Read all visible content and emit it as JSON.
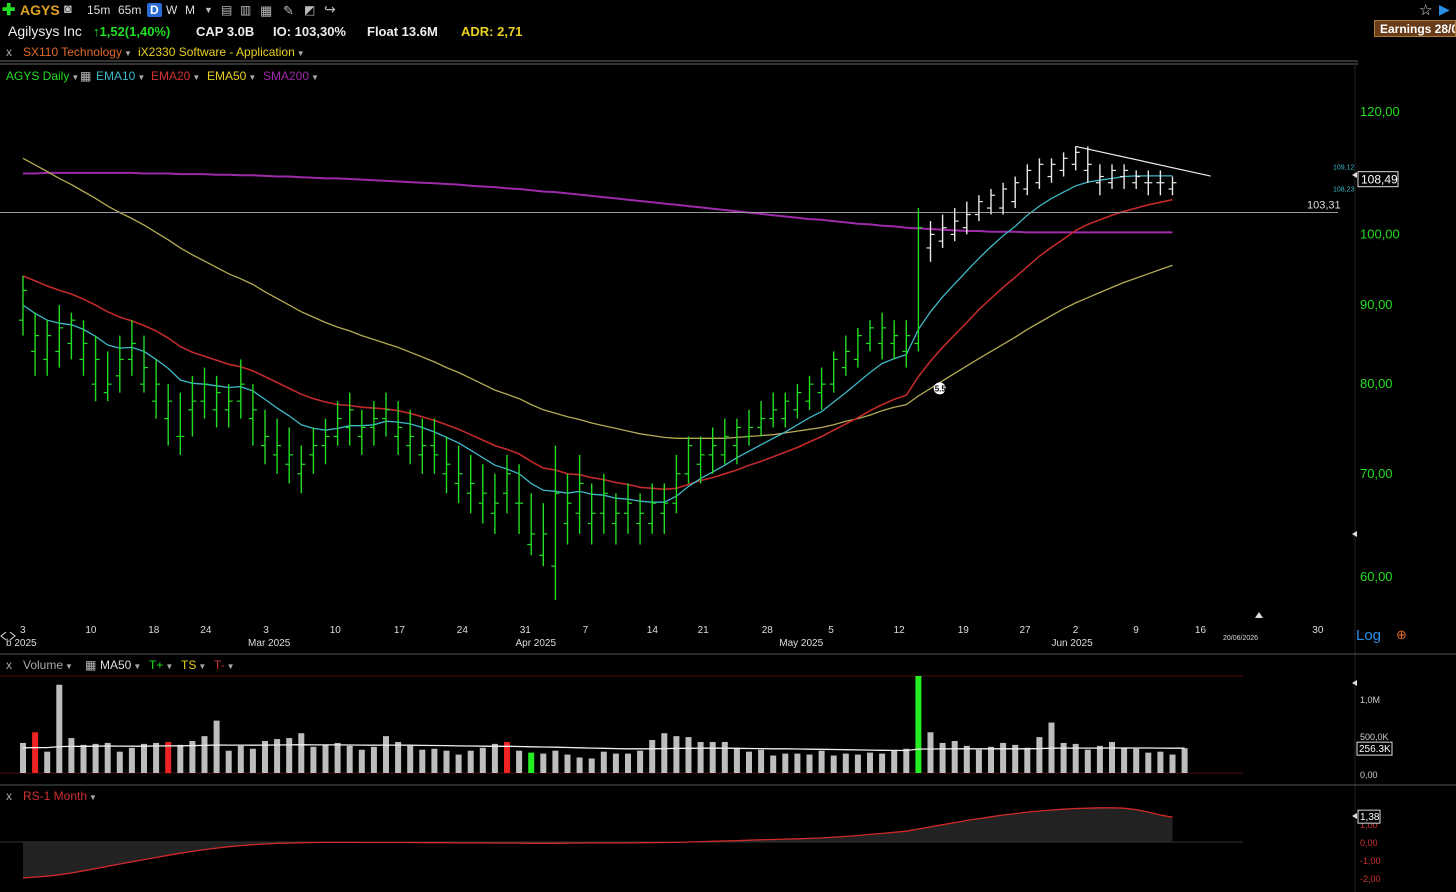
{
  "toolbar": {
    "symbol": "AGYS",
    "intervals": [
      "15m",
      "65m",
      "D",
      "W",
      "M"
    ],
    "active_interval": "D"
  },
  "info": {
    "company": "Agilysys Inc",
    "change": "1,52(1,40%)",
    "cap": "CAP 3.0B",
    "io": "IO: 103,30%",
    "float": "Float 13.6M",
    "adr": "ADR: 2,71",
    "earnings": "Earnings 28/0"
  },
  "sector": {
    "sx": "SX110 Technology",
    "ix": "iX2330 Software - Application"
  },
  "legend": {
    "symbol": "AGYS Daily",
    "ema10": "EMA10",
    "ema20": "EMA20",
    "ema50": "EMA50",
    "sma200": "SMA200"
  },
  "colors": {
    "price": "#22dd22",
    "ema10": "#3fb8c8",
    "ema20": "#c02a2a",
    "ema50": "#b3ab55",
    "sma200": "#9d2aa8",
    "volume_up": "#bdbdbd",
    "volume_hi_green": "#22ee22",
    "volume_hi_red": "#ee2222",
    "rs_line": "#d02a2a"
  },
  "price_axis": {
    "ticks": [
      "120,00",
      "100,00",
      "90,00",
      "80,00",
      "70,00",
      "60,00"
    ],
    "last_price": "108,49",
    "ema10_tag": "109,12",
    "ema20_tag": "108,23",
    "line_label": "103,31",
    "annotation": "5.54",
    "scale": "Log"
  },
  "xaxis": {
    "day_ticks": [
      "3",
      "10",
      "18",
      "24",
      "3",
      "10",
      "17",
      "24",
      "31",
      "7",
      "14",
      "21",
      "28",
      "5",
      "12",
      "19",
      "27",
      "2",
      "9",
      "16",
      "30"
    ],
    "month_labels": [
      "b 2025",
      "Mar 2025",
      "Apr 2025",
      "May 2025",
      "Jun 2025"
    ],
    "current_date": "20/06/2026"
  },
  "volume_panel": {
    "title": "Volume",
    "ma": "MA50",
    "tplus": "T+",
    "ts": "TS",
    "tminus": "T-",
    "ticks": [
      "1,0M",
      "500,0K",
      "0,00"
    ],
    "current": "256.3K"
  },
  "rs_panel": {
    "title": "RS-1 Month",
    "current": "1,38",
    "ticks": [
      "1,00",
      "0,00",
      "-1,00",
      "-2,00"
    ]
  },
  "chart_data": {
    "type": "ohlc",
    "title": "AGYS Daily",
    "ylim": [
      58,
      124
    ],
    "yscale": "log",
    "dates": [
      "2025-02-03",
      "2025-02-04",
      "2025-02-05",
      "2025-02-06",
      "2025-02-07",
      "2025-02-10",
      "2025-02-11",
      "2025-02-12",
      "2025-02-13",
      "2025-02-14",
      "2025-02-18",
      "2025-02-19",
      "2025-02-20",
      "2025-02-21",
      "2025-02-24",
      "2025-02-25",
      "2025-02-26",
      "2025-02-27",
      "2025-02-28",
      "2025-03-03",
      "2025-03-04",
      "2025-03-05",
      "2025-03-06",
      "2025-03-07",
      "2025-03-10",
      "2025-03-11",
      "2025-03-12",
      "2025-03-13",
      "2025-03-14",
      "2025-03-17",
      "2025-03-18",
      "2025-03-19",
      "2025-03-20",
      "2025-03-21",
      "2025-03-24",
      "2025-03-25",
      "2025-03-26",
      "2025-03-27",
      "2025-03-28",
      "2025-03-31",
      "2025-04-01",
      "2025-04-02",
      "2025-04-03",
      "2025-04-04",
      "2025-04-07",
      "2025-04-08",
      "2025-04-09",
      "2025-04-10",
      "2025-04-11",
      "2025-04-14",
      "2025-04-15",
      "2025-04-16",
      "2025-04-17",
      "2025-04-21",
      "2025-04-22",
      "2025-04-23",
      "2025-04-24",
      "2025-04-25",
      "2025-04-28",
      "2025-04-29",
      "2025-04-30",
      "2025-05-01",
      "2025-05-02",
      "2025-05-05",
      "2025-05-06",
      "2025-05-07",
      "2025-05-08",
      "2025-05-09",
      "2025-05-12",
      "2025-05-13",
      "2025-05-14",
      "2025-05-15",
      "2025-05-16",
      "2025-05-19",
      "2025-05-20",
      "2025-05-21",
      "2025-05-22",
      "2025-05-23",
      "2025-05-27",
      "2025-05-28",
      "2025-05-29",
      "2025-05-30",
      "2025-06-02",
      "2025-06-03",
      "2025-06-04",
      "2025-06-05",
      "2025-06-06",
      "2025-06-09",
      "2025-06-10",
      "2025-06-11",
      "2025-06-12",
      "2025-06-13",
      "2025-06-16",
      "2025-06-17",
      "2025-06-18",
      "2025-06-20"
    ],
    "ohlc": [
      [
        88,
        94,
        86,
        92
      ],
      [
        84,
        89,
        81,
        86
      ],
      [
        83,
        88,
        81,
        86
      ],
      [
        84,
        90,
        82,
        87
      ],
      [
        85,
        89,
        83,
        88
      ],
      [
        83,
        88,
        81,
        85
      ],
      [
        80,
        86,
        78,
        83
      ],
      [
        79,
        84,
        78,
        80
      ],
      [
        81,
        86,
        79,
        83
      ],
      [
        83,
        88,
        81,
        85
      ],
      [
        80,
        86,
        79,
        82
      ],
      [
        78,
        83,
        76,
        80
      ],
      [
        76,
        80,
        73,
        78
      ],
      [
        74,
        79,
        72,
        74
      ],
      [
        77,
        81,
        74,
        78
      ],
      [
        78,
        82,
        76,
        80
      ],
      [
        77,
        81,
        75,
        79
      ],
      [
        77,
        80,
        75,
        78
      ],
      [
        78,
        83,
        76,
        80
      ],
      [
        76,
        80,
        73,
        77
      ],
      [
        73,
        77,
        71,
        74
      ],
      [
        72,
        76,
        70,
        73
      ],
      [
        71,
        75,
        69,
        72
      ],
      [
        70,
        73,
        68,
        71
      ],
      [
        72,
        75,
        70,
        73
      ],
      [
        73,
        76,
        71,
        74
      ],
      [
        74,
        78,
        73,
        76
      ],
      [
        75,
        79,
        73,
        77
      ],
      [
        74,
        77,
        72,
        75
      ],
      [
        75,
        78,
        73,
        76
      ],
      [
        76,
        79,
        74,
        77
      ],
      [
        74,
        78,
        72,
        75
      ],
      [
        73,
        77,
        71,
        74
      ],
      [
        72,
        76,
        70,
        73
      ],
      [
        73,
        76,
        70,
        72
      ],
      [
        70,
        74,
        68,
        71
      ],
      [
        69,
        73,
        67,
        70
      ],
      [
        68,
        72,
        66,
        69
      ],
      [
        67,
        71,
        65,
        68
      ],
      [
        66,
        70,
        64,
        67
      ],
      [
        68,
        72,
        66,
        70
      ],
      [
        67,
        71,
        64,
        67
      ],
      [
        63,
        68,
        62,
        64
      ],
      [
        62,
        67,
        61,
        64
      ],
      [
        61,
        73,
        58,
        68
      ],
      [
        65,
        70,
        63,
        67
      ],
      [
        66,
        72,
        64,
        69
      ],
      [
        65,
        69,
        63,
        66
      ],
      [
        66,
        70,
        64,
        68
      ],
      [
        65,
        68,
        63,
        66
      ],
      [
        66,
        69,
        64,
        67
      ],
      [
        65,
        68,
        63,
        66
      ],
      [
        65,
        69,
        64,
        67
      ],
      [
        66,
        69,
        64,
        67
      ],
      [
        67,
        72,
        66,
        70
      ],
      [
        70,
        74,
        69,
        73
      ],
      [
        71,
        74,
        69,
        72
      ],
      [
        72,
        75,
        70,
        73
      ],
      [
        72,
        76,
        71,
        74
      ],
      [
        73,
        76,
        71,
        75
      ],
      [
        74,
        77,
        73,
        75
      ],
      [
        75,
        78,
        74,
        76
      ],
      [
        76,
        79,
        75,
        77
      ],
      [
        76,
        79,
        75,
        78
      ],
      [
        77,
        80,
        76,
        79
      ],
      [
        78,
        81,
        77,
        80
      ],
      [
        79,
        82,
        77,
        80
      ],
      [
        80,
        84,
        79,
        83
      ],
      [
        82,
        86,
        81,
        84
      ],
      [
        83,
        87,
        82,
        86
      ],
      [
        85,
        88,
        84,
        87
      ],
      [
        85,
        89,
        83,
        87
      ],
      [
        85,
        88,
        83,
        86
      ],
      [
        84,
        88,
        82,
        86
      ],
      [
        85,
        104,
        84,
        101
      ],
      [
        98,
        102,
        96,
        100
      ],
      [
        99,
        103,
        98,
        101
      ],
      [
        100,
        104,
        99,
        102
      ],
      [
        101,
        105,
        100,
        103
      ],
      [
        103,
        106,
        102,
        105
      ],
      [
        104,
        107,
        103,
        106
      ],
      [
        104,
        108,
        103,
        107
      ],
      [
        105,
        109,
        104,
        108
      ],
      [
        107,
        111,
        106,
        110
      ],
      [
        108,
        112,
        107,
        111
      ],
      [
        109,
        112,
        108,
        111
      ],
      [
        110,
        113,
        109,
        112
      ],
      [
        111,
        114,
        110,
        113
      ],
      [
        110,
        114,
        108,
        111
      ],
      [
        108,
        111,
        106,
        109
      ],
      [
        108,
        111,
        107,
        110
      ],
      [
        109,
        111,
        107,
        110
      ],
      [
        108,
        110,
        107,
        109
      ],
      [
        108,
        110,
        106,
        108
      ],
      [
        108,
        110,
        106,
        108
      ],
      [
        107,
        109,
        106,
        108
      ]
    ],
    "ema10": [
      90,
      88.9,
      88,
      87.6,
      87.4,
      86.8,
      85.9,
      84.8,
      84.4,
      84.5,
      84,
      83,
      81.9,
      80.5,
      80.1,
      80,
      79.8,
      79.6,
      79.7,
      79.2,
      78.2,
      77.2,
      76.3,
      75.3,
      74.9,
      74.7,
      74.9,
      75.2,
      75.2,
      75.3,
      75.7,
      75.6,
      75.4,
      75,
      74.5,
      73.9,
      73.3,
      72.5,
      71.7,
      70.9,
      70.5,
      70,
      69,
      68.3,
      68.2,
      68,
      68.2,
      67.9,
      67.8,
      67.5,
      67.4,
      67.2,
      67.1,
      67.1,
      67.7,
      68.7,
      69.5,
      70.2,
      70.9,
      71.7,
      72.4,
      73.1,
      73.8,
      74.5,
      75.3,
      76.1,
      76.8,
      77.9,
      79,
      80.2,
      81.4,
      82.5,
      83.1,
      83.6,
      86.8,
      89.1,
      91.1,
      92.9,
      94.7,
      96.5,
      98.2,
      99.8,
      101.2,
      102.9,
      104.3,
      105.5,
      106.5,
      107.5,
      108.1,
      108.4,
      108.7,
      109,
      109.1,
      109.1,
      109.1,
      109.1
    ],
    "ema20": [
      94,
      93.3,
      92.6,
      92,
      91.5,
      90.8,
      90,
      89.1,
      88.4,
      87.9,
      87.3,
      86.6,
      85.7,
      84.6,
      83.9,
      83.4,
      82.9,
      82.4,
      82.1,
      81.6,
      80.9,
      80.2,
      79.5,
      78.8,
      78.3,
      77.9,
      77.6,
      77.5,
      77.3,
      77.2,
      77.1,
      76.9,
      76.6,
      76.2,
      75.8,
      75.3,
      74.8,
      74.2,
      73.6,
      73,
      72.6,
      72.1,
      71.3,
      70.6,
      70.4,
      70,
      69.9,
      69.6,
      69.4,
      69.1,
      68.9,
      68.6,
      68.5,
      68.4,
      68.5,
      68.9,
      69.3,
      69.6,
      70,
      70.4,
      70.9,
      71.3,
      71.8,
      72.3,
      72.8,
      73.4,
      74,
      74.7,
      75.4,
      76.1,
      76.9,
      77.6,
      78.2,
      78.7,
      80.9,
      82.8,
      84.5,
      86.1,
      87.7,
      89.4,
      90.9,
      92.4,
      93.8,
      95.3,
      96.8,
      98.1,
      99.3,
      100.6,
      101.5,
      102.2,
      102.9,
      103.5,
      104,
      104.5,
      104.9,
      105.3
    ],
    "ema50": [
      112,
      110.9,
      109.8,
      108.7,
      107.7,
      106.6,
      105.5,
      104.3,
      103.3,
      102.4,
      101.4,
      100.3,
      99.2,
      98,
      97,
      96.1,
      95.2,
      94.3,
      93.6,
      92.8,
      91.8,
      90.9,
      90,
      89.1,
      88.4,
      87.7,
      87.1,
      86.6,
      86,
      85.5,
      85,
      84.5,
      83.9,
      83.3,
      82.7,
      82,
      81.4,
      80.7,
      80,
      79.3,
      78.8,
      78.3,
      77.6,
      77,
      76.6,
      76.2,
      75.9,
      75.5,
      75.2,
      74.9,
      74.6,
      74.3,
      74.1,
      73.9,
      73.8,
      73.8,
      73.8,
      73.8,
      73.8,
      73.9,
      74,
      74.1,
      74.2,
      74.4,
      74.6,
      74.8,
      75,
      75.3,
      75.7,
      76,
      76.4,
      76.9,
      77.3,
      77.6,
      78.6,
      79.5,
      80.4,
      81.3,
      82.2,
      83.1,
      84,
      84.9,
      85.8,
      86.8,
      87.7,
      88.6,
      89.5,
      90.3,
      91,
      91.7,
      92.4,
      93.1,
      93.7,
      94.3,
      94.9,
      95.5
    ],
    "sma200": [
      109.5,
      109.5,
      109.6,
      109.6,
      109.6,
      109.6,
      109.6,
      109.6,
      109.6,
      109.6,
      109.5,
      109.5,
      109.5,
      109.4,
      109.4,
      109.4,
      109.3,
      109.3,
      109.2,
      109.2,
      109.1,
      109,
      109,
      108.9,
      108.8,
      108.7,
      108.7,
      108.6,
      108.5,
      108.4,
      108.3,
      108.2,
      108.1,
      108,
      107.9,
      107.8,
      107.7,
      107.5,
      107.4,
      107.3,
      107.1,
      107,
      106.8,
      106.6,
      106.5,
      106.3,
      106.1,
      105.9,
      105.7,
      105.5,
      105.3,
      105.1,
      104.9,
      104.7,
      104.5,
      104.3,
      104.1,
      103.9,
      103.7,
      103.5,
      103.3,
      103.1,
      102.9,
      102.7,
      102.5,
      102.3,
      102.2,
      102,
      101.8,
      101.6,
      101.5,
      101.3,
      101.2,
      101,
      100.9,
      100.8,
      100.7,
      100.6,
      100.5,
      100.5,
      100.4,
      100.4,
      100.4,
      100.3,
      100.3,
      100.3,
      100.3,
      100.3,
      100.3,
      100.3,
      100.3,
      100.3,
      100.3,
      100.3,
      100.3,
      100.3
    ],
    "horizontal_line": 103.31,
    "trendline": [
      [
        87,
        114
      ],
      [
        96,
        109
      ]
    ],
    "volume": [
      310,
      420,
      220,
      910,
      360,
      290,
      300,
      310,
      220,
      260,
      300,
      310,
      320,
      290,
      330,
      380,
      540,
      230,
      280,
      250,
      330,
      350,
      360,
      410,
      270,
      290,
      310,
      280,
      240,
      270,
      380,
      320,
      280,
      240,
      250,
      230,
      190,
      230,
      260,
      300,
      320,
      230,
      210,
      200,
      230,
      190,
      160,
      150,
      220,
      200,
      200,
      230,
      340,
      410,
      380,
      370,
      320,
      320,
      320,
      260,
      220,
      240,
      180,
      200,
      200,
      190,
      230,
      180,
      200,
      190,
      210,
      200,
      230,
      250,
      1000,
      420,
      310,
      330,
      280,
      240,
      270,
      310,
      290,
      260,
      370,
      520,
      310,
      300,
      240,
      280,
      320,
      260,
      250,
      210,
      220,
      190,
      256.3
    ],
    "volume_ma50": [
      260,
      262,
      262,
      272,
      274,
      274,
      276,
      278,
      277,
      276,
      276,
      278,
      279,
      280,
      282,
      285,
      289,
      288,
      288,
      287,
      288,
      289,
      290,
      292,
      290,
      290,
      290,
      289,
      288,
      287,
      288,
      288,
      287,
      285,
      284,
      282,
      279,
      278,
      276,
      275,
      275,
      273,
      270,
      268,
      266,
      263,
      260,
      257,
      255,
      252,
      250,
      249,
      250,
      252,
      254,
      255,
      256,
      256,
      256,
      255,
      253,
      252,
      250,
      249,
      247,
      245,
      244,
      242,
      240,
      238,
      236,
      234,
      233,
      232,
      246,
      247,
      248,
      249,
      249,
      249,
      249,
      250,
      250,
      250,
      252,
      256,
      257,
      257,
      257,
      257,
      258,
      258,
      258,
      258,
      257,
      256,
      256
    ],
    "volume_highlight": {
      "green": [
        42,
        74
      ],
      "red": [
        1,
        12,
        40
      ]
    },
    "rs_1_month": [
      -2.0,
      -1.95,
      -1.9,
      -1.82,
      -1.72,
      -1.6,
      -1.48,
      -1.35,
      -1.22,
      -1.1,
      -0.98,
      -0.86,
      -0.74,
      -0.62,
      -0.52,
      -0.42,
      -0.34,
      -0.26,
      -0.2,
      -0.15,
      -0.11,
      -0.08,
      -0.06,
      -0.04,
      -0.03,
      -0.02,
      -0.02,
      -0.02,
      -0.03,
      -0.03,
      -0.03,
      -0.03,
      -0.03,
      -0.04,
      -0.04,
      -0.04,
      -0.05,
      -0.05,
      -0.05,
      -0.06,
      -0.06,
      -0.06,
      -0.07,
      -0.07,
      -0.07,
      -0.06,
      -0.06,
      -0.05,
      -0.05,
      -0.05,
      -0.05,
      -0.04,
      -0.04,
      -0.03,
      -0.02,
      0,
      0.02,
      0.04,
      0.06,
      0.08,
      0.1,
      0.12,
      0.14,
      0.16,
      0.18,
      0.2,
      0.23,
      0.27,
      0.31,
      0.36,
      0.42,
      0.48,
      0.54,
      0.6,
      0.72,
      0.84,
      0.96,
      1.08,
      1.2,
      1.3,
      1.4,
      1.5,
      1.58,
      1.66,
      1.72,
      1.78,
      1.82,
      1.86,
      1.88,
      1.9,
      1.9,
      1.88,
      1.8,
      1.66,
      1.5,
      1.38
    ]
  }
}
